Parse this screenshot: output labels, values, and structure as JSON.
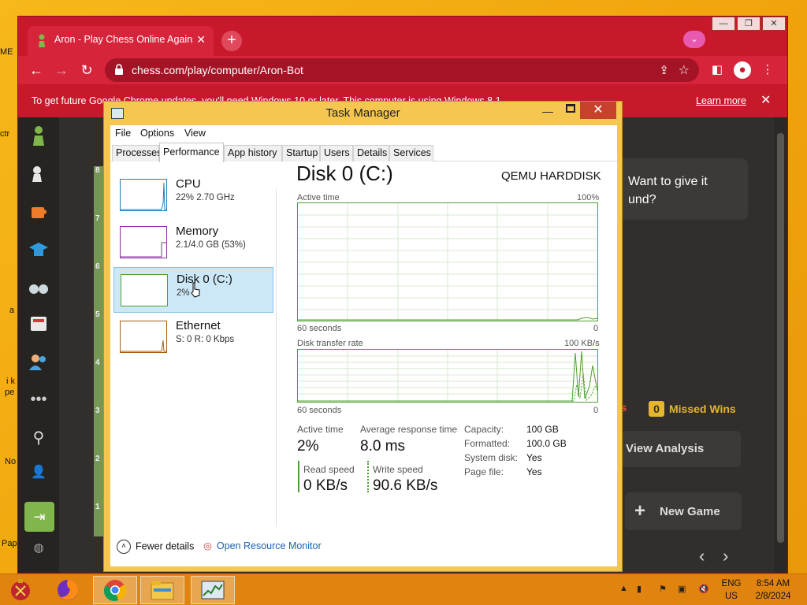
{
  "desktop": {
    "fragments": [
      "ME",
      "ctr",
      "a",
      "i k",
      "pe",
      "No",
      "Pap"
    ]
  },
  "browser": {
    "tab_title": "Aron - Play Chess Online Against",
    "url": "chess.com/play/computer/Aron-Bot",
    "infobar_message": "To get future Google Chrome updates, you'll need Windows 10 or later. This computer is using Windows 8.1.",
    "infobar_link": "Learn more"
  },
  "chess": {
    "coach_text_1": "Want to give it",
    "coach_text_2": "und?",
    "rank_labels": [
      "8",
      "7",
      "6",
      "5",
      "4",
      "3",
      "2",
      "1"
    ],
    "stat_prefix": "rs",
    "missed_count": "0",
    "missed_label": "Missed Wins",
    "view_analysis": "View Analysis",
    "new_game": "New Game"
  },
  "taskmgr": {
    "title": "Task Manager",
    "menu": [
      "File",
      "Options",
      "View"
    ],
    "tabs": [
      "Processes",
      "Performance",
      "App history",
      "Startup",
      "Users",
      "Details",
      "Services"
    ],
    "resources": [
      {
        "name": "CPU",
        "sub": "22%  2.70 GHz",
        "color": "#1c7fc3"
      },
      {
        "name": "Memory",
        "sub": "2.1/4.0 GB (53%)",
        "color": "#8b2fa3"
      },
      {
        "name": "Disk 0 (C:)",
        "sub": "2%",
        "color": "#4da032"
      },
      {
        "name": "Ethernet",
        "sub": "S: 0  R: 0 Kbps",
        "color": "#a65e12"
      }
    ],
    "detail": {
      "title": "Disk 0 (C:)",
      "model": "QEMU HARDDISK",
      "g1_label": "Active time",
      "g1_max": "100%",
      "g1_time": "60 seconds",
      "g1_min": "0",
      "g2_label": "Disk transfer rate",
      "g2_max": "100 KB/s",
      "g2_time": "60 seconds",
      "g2_min": "0",
      "active_time_label": "Active time",
      "active_time_value": "2%",
      "avg_resp_label": "Average response time",
      "avg_resp_value": "8.0 ms",
      "read_label": "Read speed",
      "read_value": "0 KB/s",
      "write_label": "Write speed",
      "write_value": "90.6 KB/s",
      "props": [
        {
          "k": "Capacity:",
          "v": "100 GB"
        },
        {
          "k": "Formatted:",
          "v": "100.0 GB"
        },
        {
          "k": "System disk:",
          "v": "Yes"
        },
        {
          "k": "Page file:",
          "v": "Yes"
        }
      ]
    },
    "fewer_details": "Fewer details",
    "open_monitor": "Open Resource Monitor"
  },
  "taskbar": {
    "lang_1": "ENG",
    "lang_2": "US",
    "time": "8:54 AM",
    "date": "2/8/2024"
  }
}
